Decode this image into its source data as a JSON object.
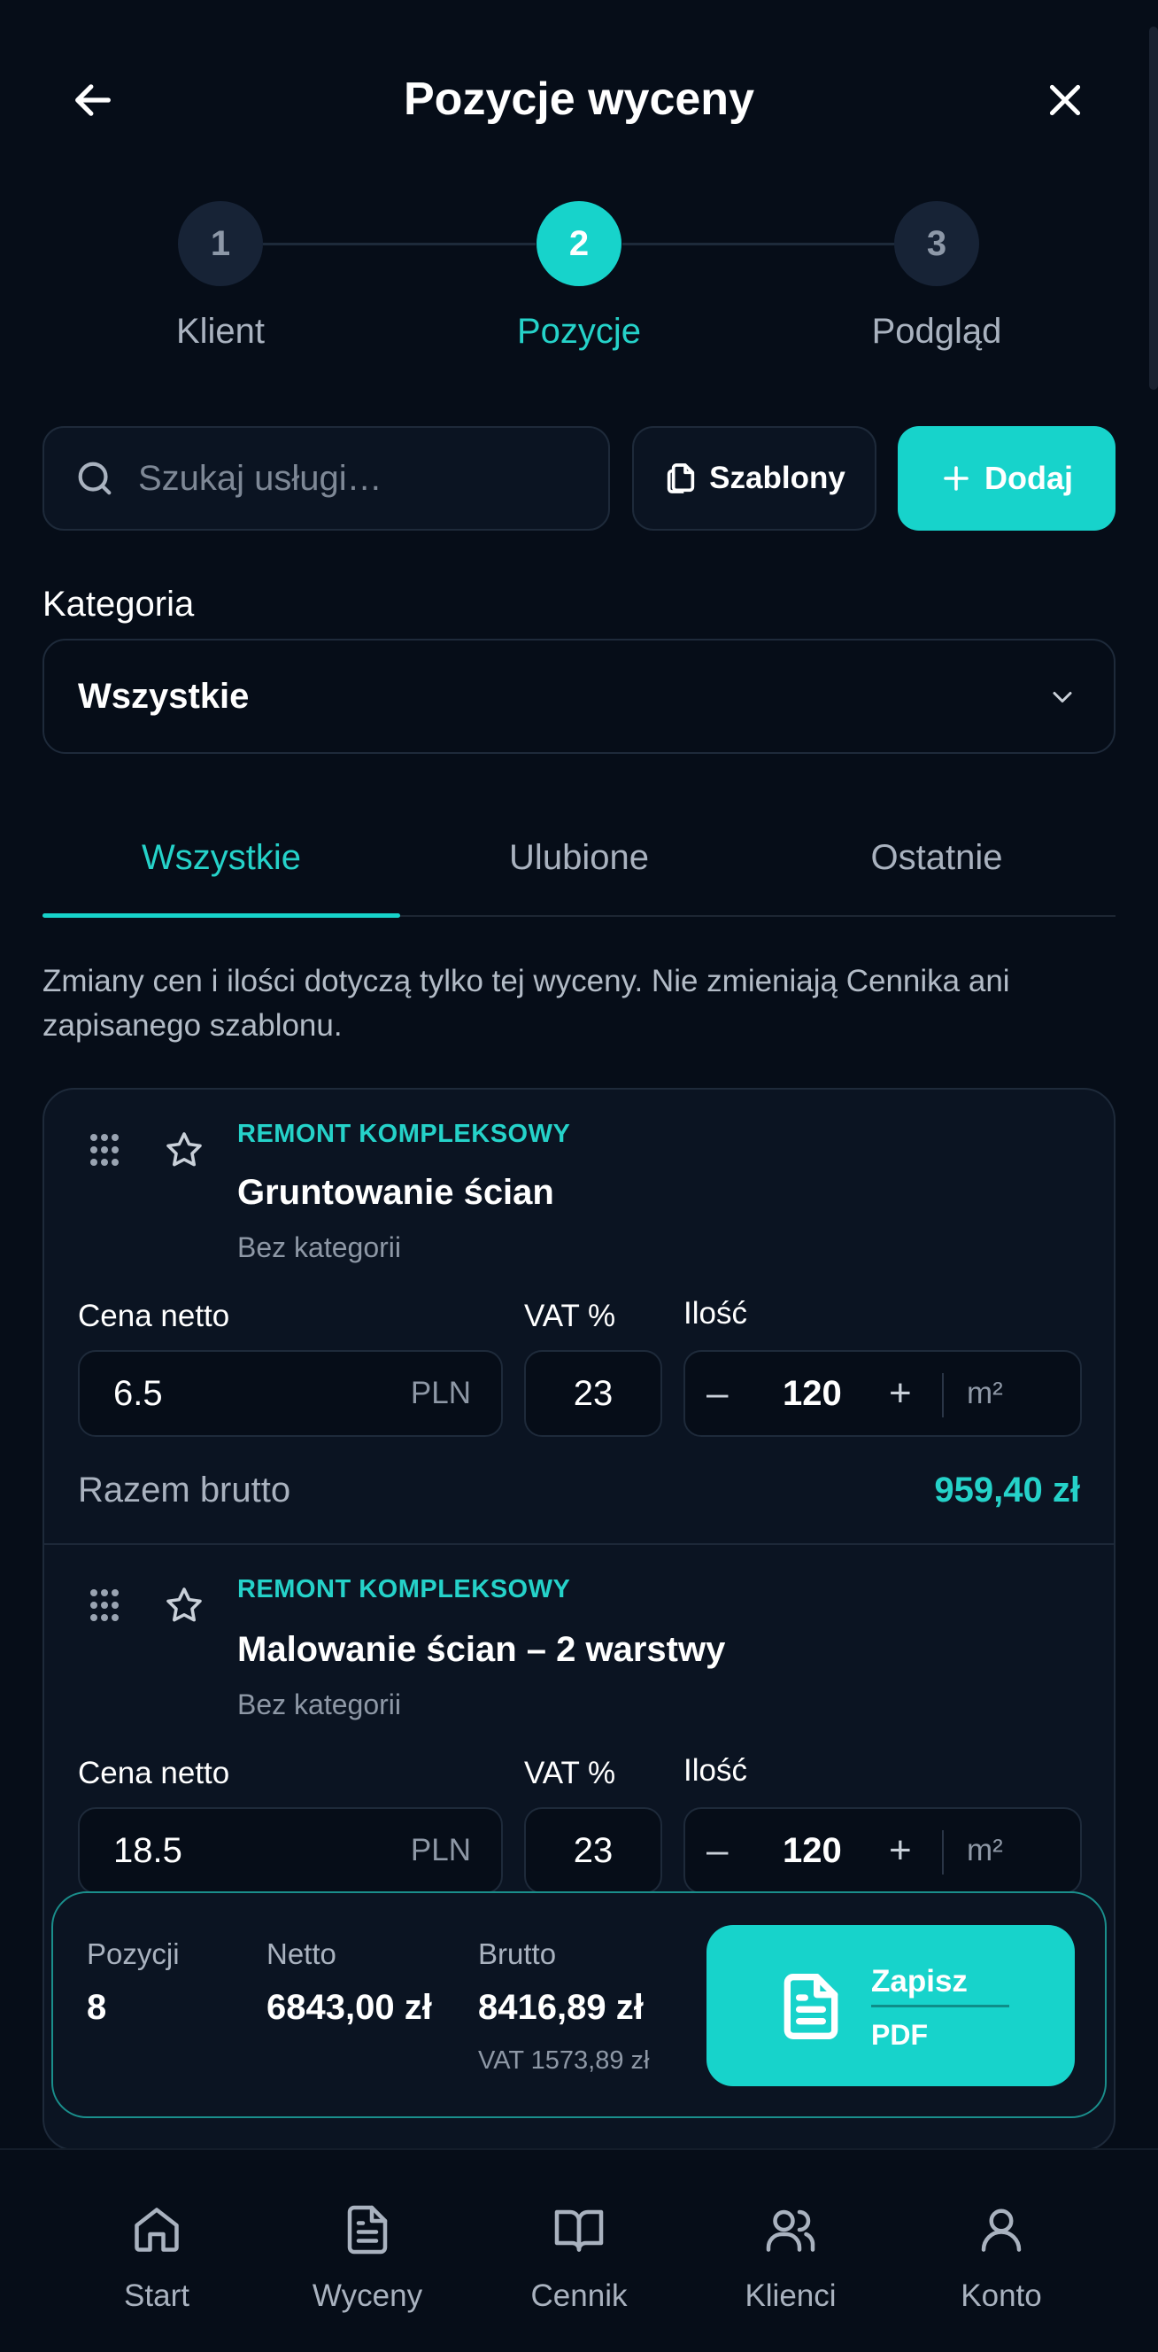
{
  "header": {
    "title": "Pozycje wyceny"
  },
  "stepper": {
    "steps": [
      {
        "number": "1",
        "label": "Klient"
      },
      {
        "number": "2",
        "label": "Pozycje"
      },
      {
        "number": "3",
        "label": "Podgląd"
      }
    ],
    "active_index": 1
  },
  "search": {
    "placeholder": "Szukaj usługi…"
  },
  "toolbar": {
    "templates_label": "Szablony",
    "add_label": "Dodaj"
  },
  "category": {
    "label": "Kategoria",
    "selected": "Wszystkie"
  },
  "tabs": [
    {
      "label": "Wszystkie",
      "active": true
    },
    {
      "label": "Ulubione",
      "active": false
    },
    {
      "label": "Ostatnie",
      "active": false
    }
  ],
  "notice": "Zmiany cen i ilości dotyczą tylko tej wyceny. Nie zmieniają Cennika ani zapisanego szablonu.",
  "field_labels": {
    "net_price": "Cena netto",
    "vat": "VAT %",
    "quantity": "Ilość",
    "total": "Razem brutto"
  },
  "items": [
    {
      "group": "REMONT KOMPLEKSOWY",
      "name": "Gruntowanie ścian",
      "category": "Bez kategorii",
      "net_price": "6.5",
      "currency": "PLN",
      "vat": "23",
      "quantity": "120",
      "unit": "m²",
      "total": "959,40 zł"
    },
    {
      "group": "REMONT KOMPLEKSOWY",
      "name": "Malowanie ścian – 2 warstwy",
      "category": "Bez kategorii",
      "net_price": "18.5",
      "currency": "PLN",
      "vat": "23",
      "quantity": "120",
      "unit": "m²"
    }
  ],
  "summary": {
    "positions_label": "Pozycji",
    "positions_value": "8",
    "net_label": "Netto",
    "net_value": "6843,00 zł",
    "gross_label": "Brutto",
    "gross_value": "8416,89 zł",
    "vat_text": "VAT 1573,89 zł",
    "save_label": "Zapisz",
    "save_sub": "PDF"
  },
  "bottom_nav": [
    {
      "label": "Start",
      "icon": "home-icon"
    },
    {
      "label": "Wyceny",
      "icon": "document-icon"
    },
    {
      "label": "Cennik",
      "icon": "book-icon"
    },
    {
      "label": "Klienci",
      "icon": "users-icon"
    },
    {
      "label": "Konto",
      "icon": "user-icon"
    }
  ],
  "colors": {
    "accent": "#17d3cb",
    "background": "#060d18",
    "card": "#0b1422",
    "muted": "#a9b2bf"
  }
}
